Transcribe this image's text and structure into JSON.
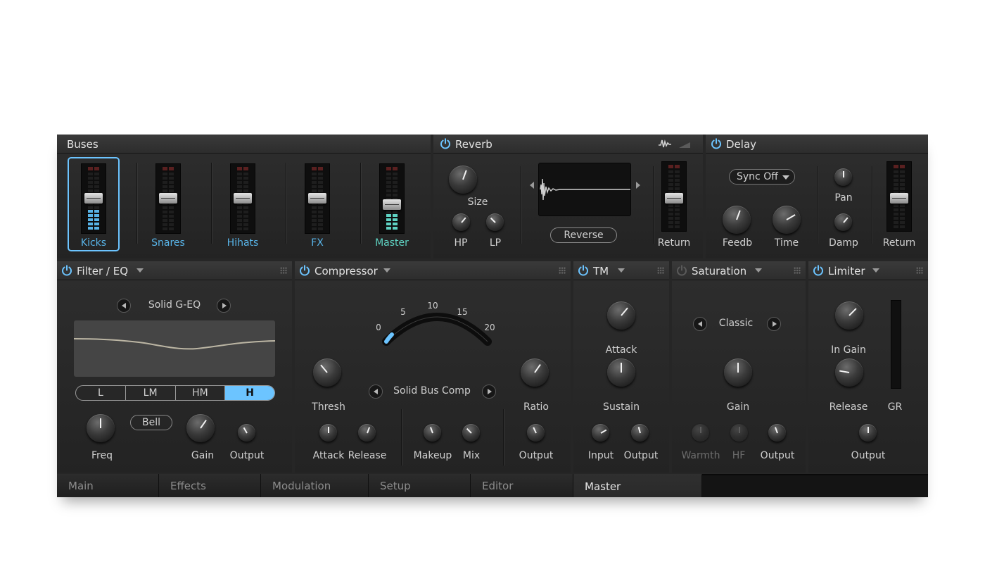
{
  "colors": {
    "accent": "#6cc4ff",
    "meter_blue": "#58b4e8",
    "meter_teal": "#5ed2c2"
  },
  "buses": {
    "title": "Buses",
    "channels": [
      {
        "label": "Kicks",
        "selected": true,
        "level": 0.35
      },
      {
        "label": "Snares",
        "selected": false,
        "level": 0
      },
      {
        "label": "Hihats",
        "selected": false,
        "level": 0
      },
      {
        "label": "FX",
        "selected": false,
        "level": 0
      },
      {
        "label": "Master",
        "selected": false,
        "level": 0.27
      }
    ]
  },
  "reverb": {
    "title": "Reverb",
    "size_label": "Size",
    "hp_label": "HP",
    "lp_label": "LP",
    "reverse_label": "Reverse",
    "return_label": "Return",
    "icons": [
      "waveform-icon",
      "ramp-icon"
    ]
  },
  "delay": {
    "title": "Delay",
    "sync_label": "Sync Off",
    "feedb_label": "Feedb",
    "time_label": "Time",
    "pan_label": "Pan",
    "damp_label": "Damp",
    "return_label": "Return"
  },
  "filter_eq": {
    "title": "Filter / EQ",
    "preset": "Solid G-EQ",
    "bands": [
      "L",
      "LM",
      "HM",
      "H"
    ],
    "active_band": "H",
    "bell_label": "Bell",
    "freq_label": "Freq",
    "gain_label": "Gain",
    "output_label": "Output"
  },
  "compressor": {
    "title": "Compressor",
    "preset": "Solid Bus Comp",
    "scale": [
      "0",
      "5",
      "10",
      "15",
      "20"
    ],
    "thresh_label": "Thresh",
    "ratio_label": "Ratio",
    "attack_label": "Attack",
    "release_label": "Release",
    "makeup_label": "Makeup",
    "mix_label": "Mix",
    "output_label": "Output"
  },
  "tm": {
    "title": "TM",
    "attack_label": "Attack",
    "sustain_label": "Sustain",
    "input_label": "Input",
    "output_label": "Output"
  },
  "saturation": {
    "title": "Saturation",
    "preset": "Classic",
    "gain_label": "Gain",
    "warmth_label": "Warmth",
    "hf_label": "HF",
    "output_label": "Output"
  },
  "limiter": {
    "title": "Limiter",
    "in_gain_label": "In Gain",
    "release_label": "Release",
    "gr_label": "GR",
    "output_label": "Output"
  },
  "tabs": [
    {
      "label": "Main",
      "active": false
    },
    {
      "label": "Effects",
      "active": false
    },
    {
      "label": "Modulation",
      "active": false
    },
    {
      "label": "Setup",
      "active": false
    },
    {
      "label": "Editor",
      "active": false
    },
    {
      "label": "Master",
      "active": true
    }
  ]
}
